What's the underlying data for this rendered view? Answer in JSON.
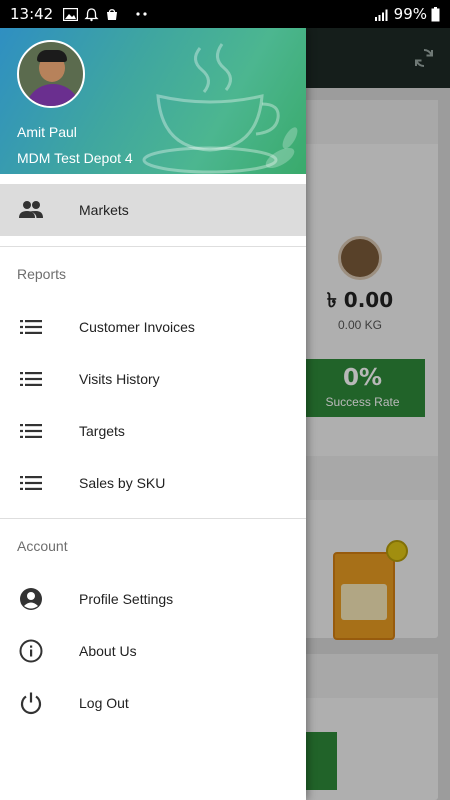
{
  "status_bar": {
    "time": "13:42",
    "battery": "99%",
    "icons": [
      "image-icon",
      "alarm-icon",
      "bag-icon",
      "more-dots-icon",
      "signal-icon",
      "battery-icon"
    ]
  },
  "background": {
    "amount": "৳ 0.00",
    "weight": "0.00 KG",
    "success_pct": "0%",
    "success_label": "Success Rate"
  },
  "drawer": {
    "user_name": "Amit Paul",
    "depot": "MDM Test Depot 4",
    "top_items": [
      {
        "label": "Markets",
        "icon": "people-icon",
        "active": true
      }
    ],
    "reports": {
      "title": "Reports",
      "items": [
        {
          "label": "Customer Invoices",
          "icon": "list-icon"
        },
        {
          "label": "Visits History",
          "icon": "list-icon"
        },
        {
          "label": "Targets",
          "icon": "list-icon"
        },
        {
          "label": "Sales by SKU",
          "icon": "list-icon"
        }
      ]
    },
    "account": {
      "title": "Account",
      "items": [
        {
          "label": "Profile Settings",
          "icon": "account-circle-icon"
        },
        {
          "label": "About Us",
          "icon": "info-icon"
        },
        {
          "label": "Log Out",
          "icon": "power-icon"
        }
      ]
    }
  },
  "colors": {
    "accent_green": "#2f8a3a",
    "toolbar_dark": "#1e2a26",
    "active_item_bg": "#dcdcdc"
  }
}
